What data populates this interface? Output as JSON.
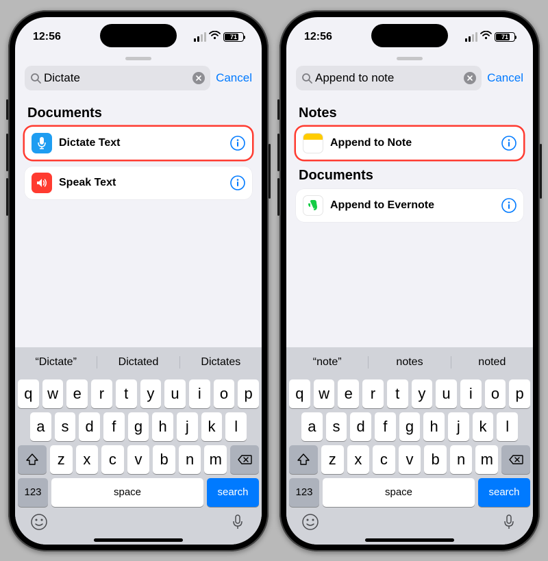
{
  "status": {
    "time": "12:56",
    "battery": "71"
  },
  "cancel_label": "Cancel",
  "keyboard": {
    "rows": [
      [
        "q",
        "w",
        "e",
        "r",
        "t",
        "y",
        "u",
        "i",
        "o",
        "p"
      ],
      [
        "a",
        "s",
        "d",
        "f",
        "g",
        "h",
        "j",
        "k",
        "l"
      ],
      [
        "z",
        "x",
        "c",
        "v",
        "b",
        "n",
        "m"
      ]
    ],
    "num": "123",
    "space": "space",
    "search": "search"
  },
  "left": {
    "search_value": "Dictate",
    "suggestions": [
      "“Dictate”",
      "Dictated",
      "Dictates"
    ],
    "sections": [
      {
        "title": "Documents",
        "items": [
          {
            "icon": "mic",
            "label": "Dictate Text",
            "highlight": true
          },
          {
            "icon": "speak",
            "label": "Speak Text",
            "highlight": false
          }
        ]
      }
    ]
  },
  "right": {
    "search_value": "Append to note",
    "suggestions": [
      "“note”",
      "notes",
      "noted"
    ],
    "sections": [
      {
        "title": "Notes",
        "items": [
          {
            "icon": "notes",
            "label": "Append to Note",
            "highlight": true
          }
        ]
      },
      {
        "title": "Documents",
        "items": [
          {
            "icon": "evernote",
            "label": "Append to Evernote",
            "highlight": false
          }
        ]
      }
    ]
  }
}
